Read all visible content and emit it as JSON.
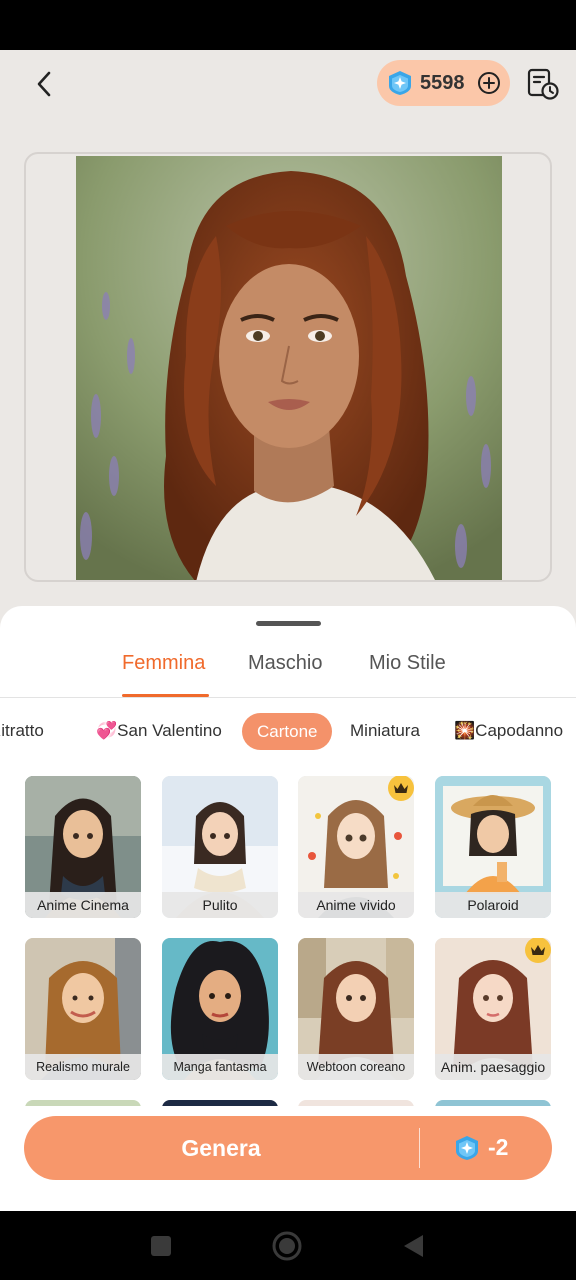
{
  "header": {
    "credits": "5598"
  },
  "gender_tabs": [
    "Femmina",
    "Maschio",
    "Mio Stile"
  ],
  "categories": [
    {
      "label": "Ritratto",
      "emoji": ""
    },
    {
      "label": "San Valentino",
      "emoji": "💞"
    },
    {
      "label": "Cartone",
      "emoji": ""
    },
    {
      "label": "Miniatura",
      "emoji": ""
    },
    {
      "label": "Capodanno",
      "emoji": "🎇"
    }
  ],
  "styles": [
    {
      "label": "Anime Cinema",
      "premium": false
    },
    {
      "label": "Pulito",
      "premium": false
    },
    {
      "label": "Anime vivido",
      "premium": true
    },
    {
      "label": "Polaroid",
      "premium": false
    },
    {
      "label": "Realismo murale",
      "premium": false
    },
    {
      "label": "Manga fantasma",
      "premium": false
    },
    {
      "label": "Webtoon coreano",
      "premium": false
    },
    {
      "label": "Anim. paesaggio",
      "premium": true
    }
  ],
  "generate": {
    "label": "Genera",
    "cost": "-2"
  },
  "colors": {
    "accent": "#f06a2c",
    "button": "#f7976b",
    "pill": "#fbc7a9",
    "gem": "#3aa6e8",
    "crown": "#f7c23d"
  }
}
